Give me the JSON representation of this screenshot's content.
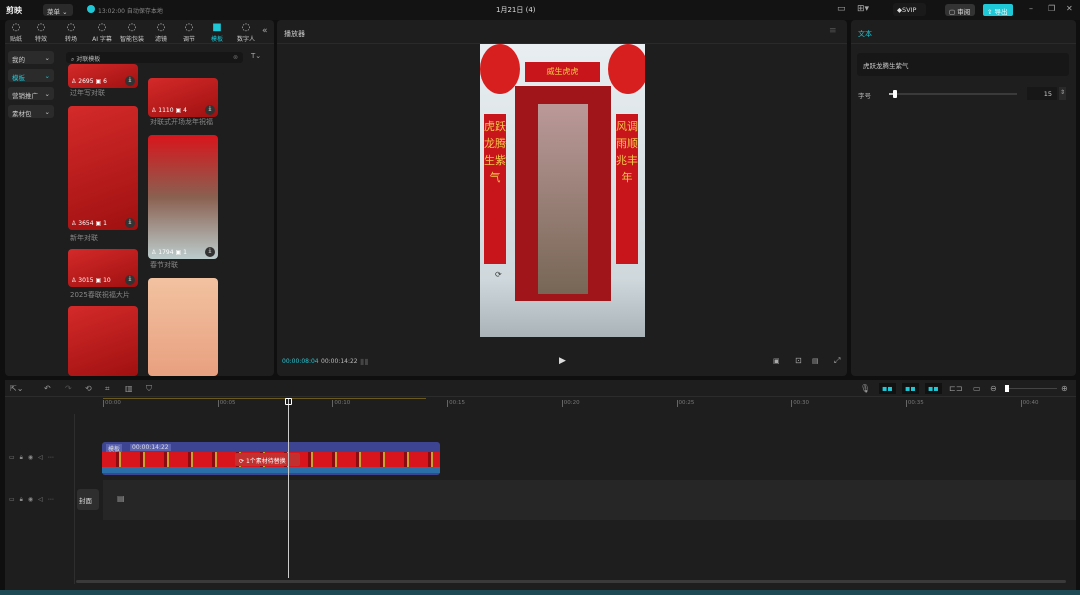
{
  "app": {
    "logo": "剪映",
    "menu": "菜单",
    "autosave": "13:02:00 自动保存本地",
    "title": "1月21日 (4)",
    "svip": "SVIP",
    "review": "审阅",
    "export": "导出",
    "accent": "#1fc8d6"
  },
  "toolbar": [
    {
      "label": "贴纸",
      "icon": "sticker-icon"
    },
    {
      "label": "特效",
      "icon": "effects-icon"
    },
    {
      "label": "转场",
      "icon": "transition-icon"
    },
    {
      "label": "AI 字幕",
      "icon": "subtitle-icon"
    },
    {
      "label": "智能包装",
      "icon": "package-icon"
    },
    {
      "label": "滤镜",
      "icon": "filter-icon"
    },
    {
      "label": "调节",
      "icon": "adjust-icon"
    },
    {
      "label": "模板",
      "icon": "template-icon",
      "active": true
    },
    {
      "label": "数字人",
      "icon": "avatar-icon"
    }
  ],
  "sidebar": [
    {
      "label": "我的"
    },
    {
      "label": "模板",
      "active": true
    },
    {
      "label": "营销推广"
    },
    {
      "label": "素材包"
    }
  ],
  "search": {
    "value": "对联模板"
  },
  "templates": [
    {
      "title": "过年写对联",
      "uses": "2695",
      "clips": "6"
    },
    {
      "title": "对联式开场龙年祝福",
      "uses": "1110",
      "clips": "4"
    },
    {
      "title": "新年对联",
      "uses": "3654",
      "clips": "1"
    },
    {
      "title": "春节对联",
      "uses": "1794",
      "clips": "1"
    },
    {
      "title": "2025春联祝福大片",
      "uses": "3015",
      "clips": "10"
    },
    {
      "title": "",
      "uses": "",
      "clips": ""
    },
    {
      "title": "",
      "uses": "",
      "clips": ""
    }
  ],
  "player": {
    "title": "播放器",
    "current": "00:00:08:04",
    "total": "00:00:14:22",
    "preview_banner": "威生虎虎",
    "left_couplet": "虎跃龙腾生紫气",
    "right_couplet": "风调雨顺兆丰年"
  },
  "inspector": {
    "tab": "文本",
    "text_value": "虎跃龙腾生紫气",
    "font_size_label": "字号",
    "font_size": "15",
    "font_size_fraction": 0.05
  },
  "timeline": {
    "ticks": [
      "00:00",
      "00:05",
      "00:10",
      "00:15",
      "00:20",
      "00:25",
      "00:30",
      "00:35",
      "00:40"
    ],
    "clip_label": "模板",
    "clip_duration": "00:00:14:22",
    "replace_notice": "1个素材待替换",
    "cover": "封面",
    "playhead_time": "00:00:08:04"
  }
}
